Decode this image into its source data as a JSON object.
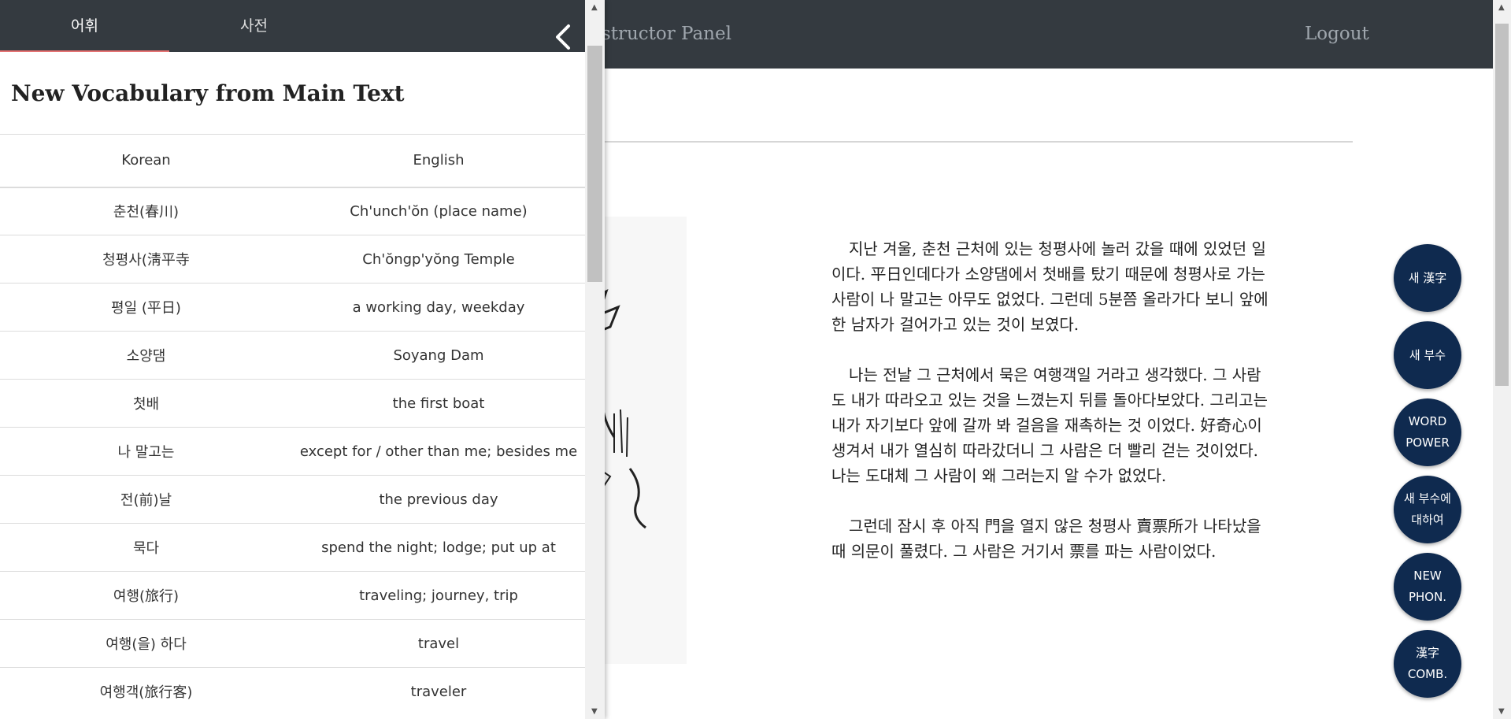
{
  "topbar": {
    "panel_title": "Instructor Panel",
    "logout_label": "Logout"
  },
  "drawer": {
    "tabs": [
      {
        "label": "어휘",
        "active": true
      },
      {
        "label": "사전",
        "active": false
      }
    ],
    "close_icon": "chevron-left-icon",
    "title": "New Vocabulary from Main Text",
    "table": {
      "headers": {
        "korean": "Korean",
        "english": "English"
      },
      "rows": [
        {
          "korean": "춘천(春川)",
          "english": "Ch'unch'ŏn (place name)"
        },
        {
          "korean": "청평사(淸平寺",
          "english": "Ch'ŏngp'yŏng Temple"
        },
        {
          "korean": "평일 (平日)",
          "english": "a working day, weekday"
        },
        {
          "korean": "소양댐",
          "english": "Soyang Dam"
        },
        {
          "korean": "첫배",
          "english": "the first boat"
        },
        {
          "korean": "나 말고는",
          "english": "except for / other than me; besides me"
        },
        {
          "korean": "전(前)날",
          "english": "the previous day"
        },
        {
          "korean": "묵다",
          "english": "spend the night; lodge; put up at"
        },
        {
          "korean": "여행(旅行)",
          "english": "traveling; journey, trip"
        },
        {
          "korean": "여행(을) 하다",
          "english": "travel"
        },
        {
          "korean": "여행객(旅行客)",
          "english": "traveler"
        }
      ]
    }
  },
  "story": {
    "paragraphs": [
      "지난 겨울, 춘천 근처에 있는 청평사에 놀러 갔을 때에 있었던 일이다. 平日인데다가 소양댐에서 첫배를 탔기 때문에 청평사로 가는 사람이 나 말고는 아무도 없었다. 그런데 5분쯤 올라가다 보니 앞에 한 남자가 걸어가고 있는 것이 보였다.",
      "나는 전날 그 근처에서 묵은 여행객일 거라고 생각했다. 그 사람도 내가 따라오고 있는 것을 느꼈는지 뒤를 돌아다보았다. 그리고는 내가 자기보다 앞에 갈까 봐 걸음을 재촉하는 것 이었다. 好奇心이 생겨서 내가 열심히 따라갔더니 그 사람은 더 빨리 걷는 것이었다. 나는 도대체 그 사람이 왜 그러는지 알 수가 없었다.",
      "그런데 잠시 후 아직 門을 열지 않은 청평사 賣票所가 나타났을 때 의문이 풀렸다. 그 사람은 거기서 票를 파는 사람이었다."
    ]
  },
  "fabs": [
    {
      "line1": "새 漢字",
      "line2": ""
    },
    {
      "line1": "새 부수",
      "line2": ""
    },
    {
      "line1": "WORD",
      "line2": "POWER"
    },
    {
      "line1": "새 부수에",
      "line2": "대하여"
    },
    {
      "line1": "NEW",
      "line2": "PHON."
    },
    {
      "line1": "漢字",
      "line2": "COMB."
    }
  ],
  "colors": {
    "topbar": "#343a40",
    "fab": "#0f2a4f",
    "tab_underline": "#e57373"
  }
}
